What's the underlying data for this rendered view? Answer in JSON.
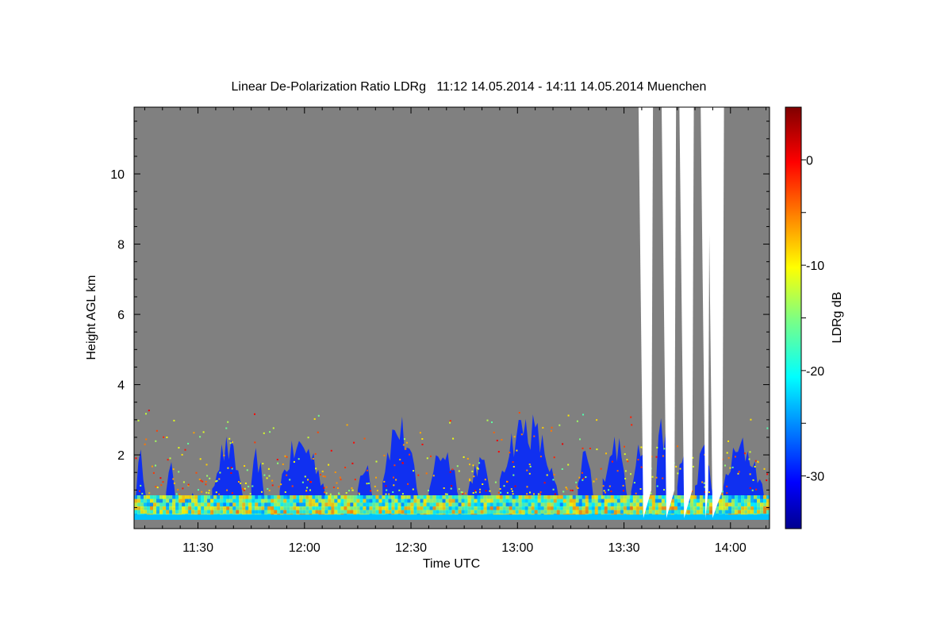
{
  "chart_data": {
    "type": "heatmap",
    "title": "Linear De-Polarization Ratio LDRg   11:12 14.05.2014 - 14:11 14.05.2014 Muenchen",
    "xlabel": "Time UTC",
    "ylabel": "Height AGL km",
    "colorbar_label": "LDRg dB",
    "x_range_minutes_utc": [
      672,
      851
    ],
    "x_ticks": [
      {
        "label": "11:30",
        "minute": 690
      },
      {
        "label": "12:00",
        "minute": 720
      },
      {
        "label": "12:30",
        "minute": 750
      },
      {
        "label": "13:00",
        "minute": 780
      },
      {
        "label": "13:30",
        "minute": 810
      },
      {
        "label": "14:00",
        "minute": 840
      }
    ],
    "ylim": [
      -0.1,
      11.9
    ],
    "y_ticks": [
      2,
      4,
      6,
      8,
      10
    ],
    "colorbar_range": [
      -35,
      5
    ],
    "colorbar_ticks": [
      0,
      -10,
      -20,
      -30
    ],
    "colors": {
      "background_no_signal": "#808080",
      "no_data": "#ffffff",
      "colormap": "jet"
    },
    "cloud_regions": [
      {
        "start": 672.5,
        "end": 676,
        "top": 2.2
      },
      {
        "start": 681,
        "end": 684,
        "top": 1.9
      },
      {
        "start": 687,
        "end": 690,
        "top": 1.0
      },
      {
        "start": 694,
        "end": 704,
        "top": 2.6
      },
      {
        "start": 705,
        "end": 709,
        "top": 2.3
      },
      {
        "start": 713,
        "end": 728,
        "top": 2.7
      },
      {
        "start": 735,
        "end": 740,
        "top": 2.2
      },
      {
        "start": 742,
        "end": 753,
        "top": 3.3
      },
      {
        "start": 755,
        "end": 765,
        "top": 2.5
      },
      {
        "start": 766,
        "end": 774,
        "top": 2.1
      },
      {
        "start": 775,
        "end": 793,
        "top": 3.4
      },
      {
        "start": 797,
        "end": 802,
        "top": 2.4
      },
      {
        "start": 804,
        "end": 812,
        "top": 2.8
      },
      {
        "start": 812,
        "end": 818,
        "top": 2.6
      },
      {
        "start": 819,
        "end": 824,
        "top": 3.3
      },
      {
        "start": 825,
        "end": 829,
        "top": 2.5
      },
      {
        "start": 830,
        "end": 836,
        "top": 2.4
      },
      {
        "start": 838,
        "end": 851,
        "top": 2.6
      }
    ],
    "no_data_gaps": [
      {
        "start": 815.0,
        "end": 817.5
      },
      {
        "start": 821.5,
        "end": 824.0
      },
      {
        "start": 826.5,
        "end": 829.0
      },
      {
        "start": 832.5,
        "end": 833.5
      },
      {
        "start": 834.5,
        "end": 837.5
      }
    ]
  }
}
